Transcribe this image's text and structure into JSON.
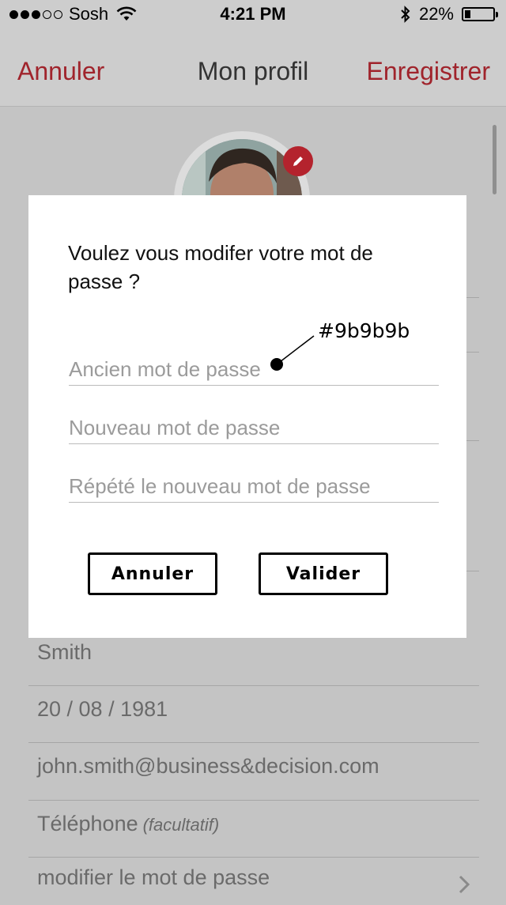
{
  "status_bar": {
    "carrier": "Sosh",
    "time": "4:21 PM",
    "battery": "22%",
    "battery_level": 0.22,
    "signal_bars_filled": 3,
    "signal_bars_total": 5,
    "icons": [
      "wifi-icon",
      "bluetooth-icon",
      "battery-icon"
    ]
  },
  "nav": {
    "cancel_label": "Annuler",
    "title": "Mon profil",
    "save_label": "Enregistrer",
    "accent_color": "#a0242c"
  },
  "profile_fields": {
    "last_name": "Smith",
    "birth_date": "20 / 08 / 1981",
    "email": "john.smith@business&decision.com",
    "phone_label": "Téléphone",
    "phone_optional": "(facultatif)",
    "change_password_label": "modifier le mot de passe"
  },
  "dialog": {
    "message": "Voulez vous modifer votre mot de passe ?",
    "old_password_placeholder": "Ancien mot de passe",
    "new_password_placeholder": "Nouveau mot de passe",
    "repeat_password_placeholder": "Répété le nouveau mot de passe",
    "cancel_label": "Annuler",
    "validate_label": "Valider"
  },
  "annotation": {
    "color_label": "#9b9b9b"
  }
}
